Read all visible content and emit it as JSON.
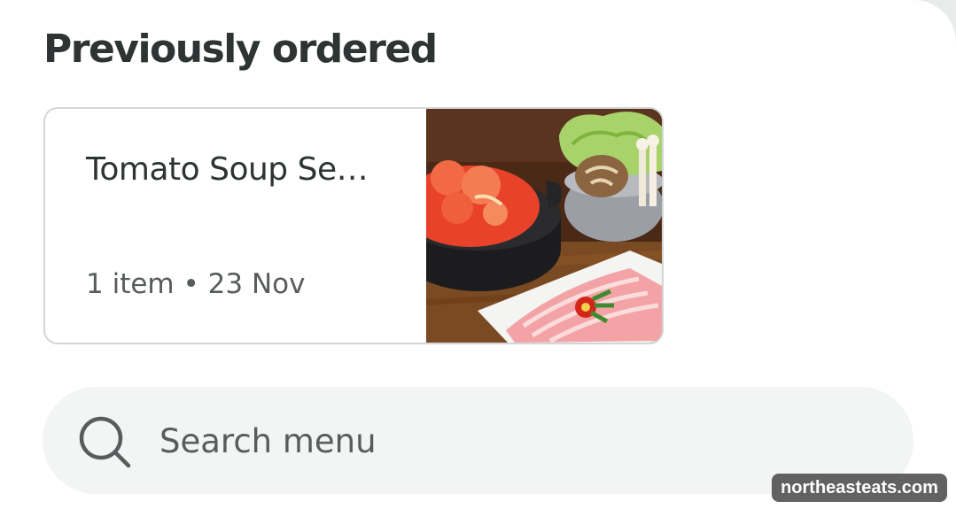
{
  "section": {
    "title": "Previously ordered"
  },
  "previous_order": {
    "name": "Tomato Soup Se…",
    "item_count": "1 item",
    "separator": "•",
    "date": "23 Nov",
    "image_icon": "hotpot-food-photo"
  },
  "search": {
    "placeholder": "Search menu",
    "icon": "search-icon"
  },
  "watermark": {
    "text": "northeasteats.com"
  },
  "colors": {
    "text_primary": "#2e3333",
    "text_secondary": "#585c5c",
    "card_border": "#d4d6d6",
    "search_background": "#f3f5f5"
  }
}
